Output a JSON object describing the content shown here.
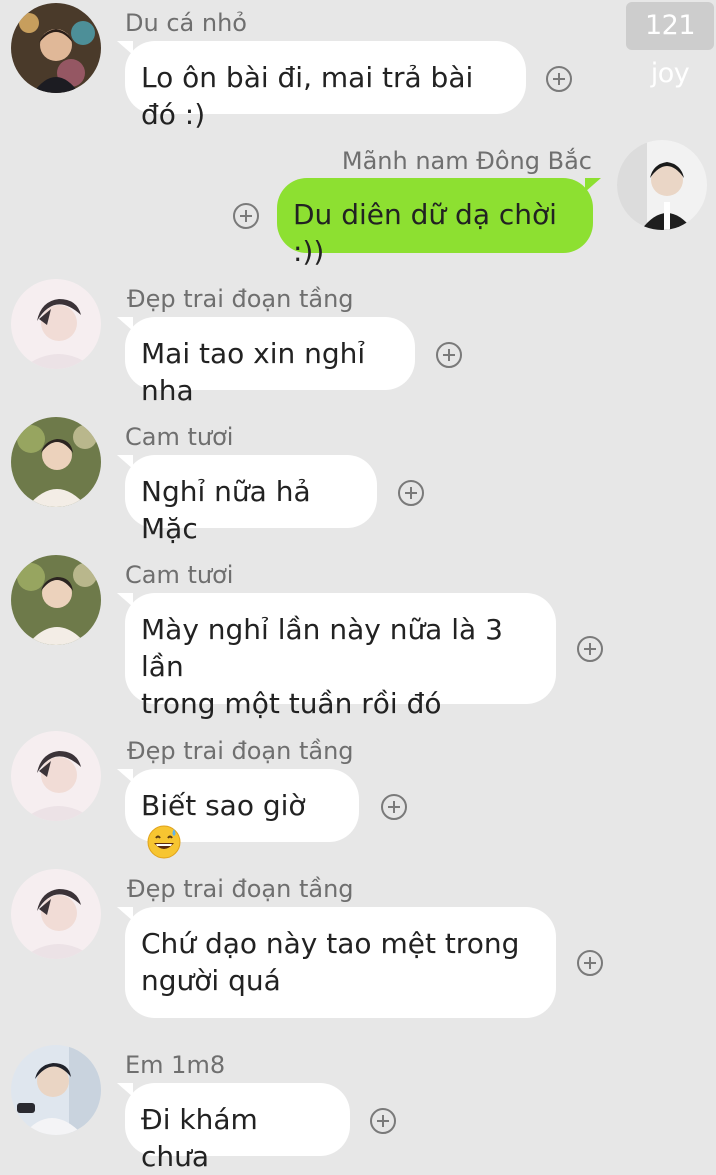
{
  "watermark": "121 joy",
  "messages": [
    {
      "sender": "Du cá nhỏ",
      "text": "Lo ôn bài đi, mai trả bài đó :)",
      "avatar": "avatar-du-ca-nho"
    },
    {
      "sender": "Mãnh nam Đông Bắc",
      "text": "Du diên dữ dạ chời :))",
      "avatar": "avatar-manh-nam-dong-bac",
      "mine": true
    },
    {
      "sender": "Đẹp trai đoạn tầng",
      "text": "Mai tao xin nghỉ nha",
      "avatar": "avatar-dep-trai-doan-tang"
    },
    {
      "sender": "Cam tươi",
      "text": "Nghỉ nữa hả Mặc",
      "avatar": "avatar-cam-tuoi"
    },
    {
      "sender": "Cam tươi",
      "text_lines": [
        "Mày nghỉ lần này nữa là 3 lần",
        "trong một tuần rồi đó"
      ],
      "avatar": "avatar-cam-tuoi"
    },
    {
      "sender": "Đẹp trai đoạn tầng",
      "text": "Biết sao giờ",
      "emoji": "grinning-sweat-emoji",
      "avatar": "avatar-dep-trai-doan-tang"
    },
    {
      "sender": "Đẹp trai đoạn tầng",
      "text_lines": [
        "Chứ dạo này tao mệt trong",
        "người quá"
      ],
      "avatar": "avatar-dep-trai-doan-tang"
    },
    {
      "sender": "Em 1m8",
      "text": "Đi khám chưa",
      "avatar": "avatar-em-1m8"
    }
  ],
  "icons": {
    "reaction": "add-reaction-icon"
  },
  "colors": {
    "background": "#e7e7e7",
    "incoming_bubble": "#ffffff",
    "outgoing_bubble": "#8de031",
    "sender_text": "#6f6f6f"
  }
}
